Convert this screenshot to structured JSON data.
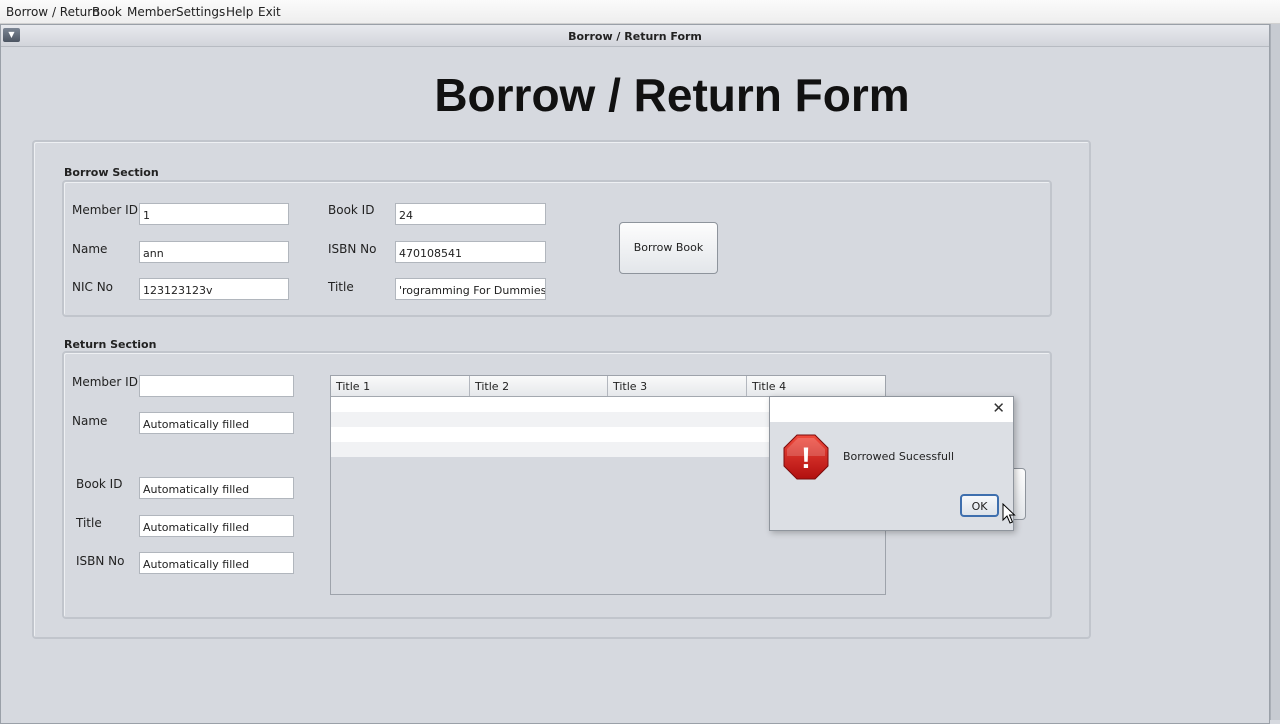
{
  "menubar": {
    "items": [
      "Borrow / Return",
      "Book",
      "Member",
      "Settings",
      "Help",
      "Exit"
    ]
  },
  "frame": {
    "title": "Borrow / Return Form"
  },
  "heading": "Borrow / Return Form",
  "borrow_section": {
    "title": "Borrow Section",
    "member_id": {
      "label": "Member ID",
      "value": "1"
    },
    "name": {
      "label": "Name",
      "value": "ann"
    },
    "nic_no": {
      "label": "NIC No",
      "value": "123123123v"
    },
    "book_id": {
      "label": "Book ID",
      "value": "24"
    },
    "isbn_no": {
      "label": "ISBN No",
      "value": "470108541"
    },
    "title_field": {
      "label": "Title",
      "value": "'rogramming  For Dummies"
    },
    "borrow_button": "Borrow Book"
  },
  "return_section": {
    "title": "Return Section",
    "member_id": {
      "label": "Member ID",
      "value": ""
    },
    "name": {
      "label": "Name",
      "value": "Automatically filled"
    },
    "book_id": {
      "label": "Book ID",
      "value": "Automatically filled"
    },
    "title_field": {
      "label": "Title",
      "value": "Automatically filled"
    },
    "isbn_no": {
      "label": "ISBN No",
      "value": "Automatically filled"
    },
    "table": {
      "columns": [
        "Title 1",
        "Title 2",
        "Title 3",
        "Title 4"
      ]
    }
  },
  "dialog": {
    "icon": "error-icon",
    "message": "Borrowed Sucessfull",
    "ok_button": "OK",
    "close_glyph": "✕",
    "icon_glyph": "!"
  },
  "colors": {
    "background": "#d6d9df",
    "panel_border": "#c1c5cc",
    "error_red": "#d21c1c",
    "ok_border": "#3e6fae"
  }
}
